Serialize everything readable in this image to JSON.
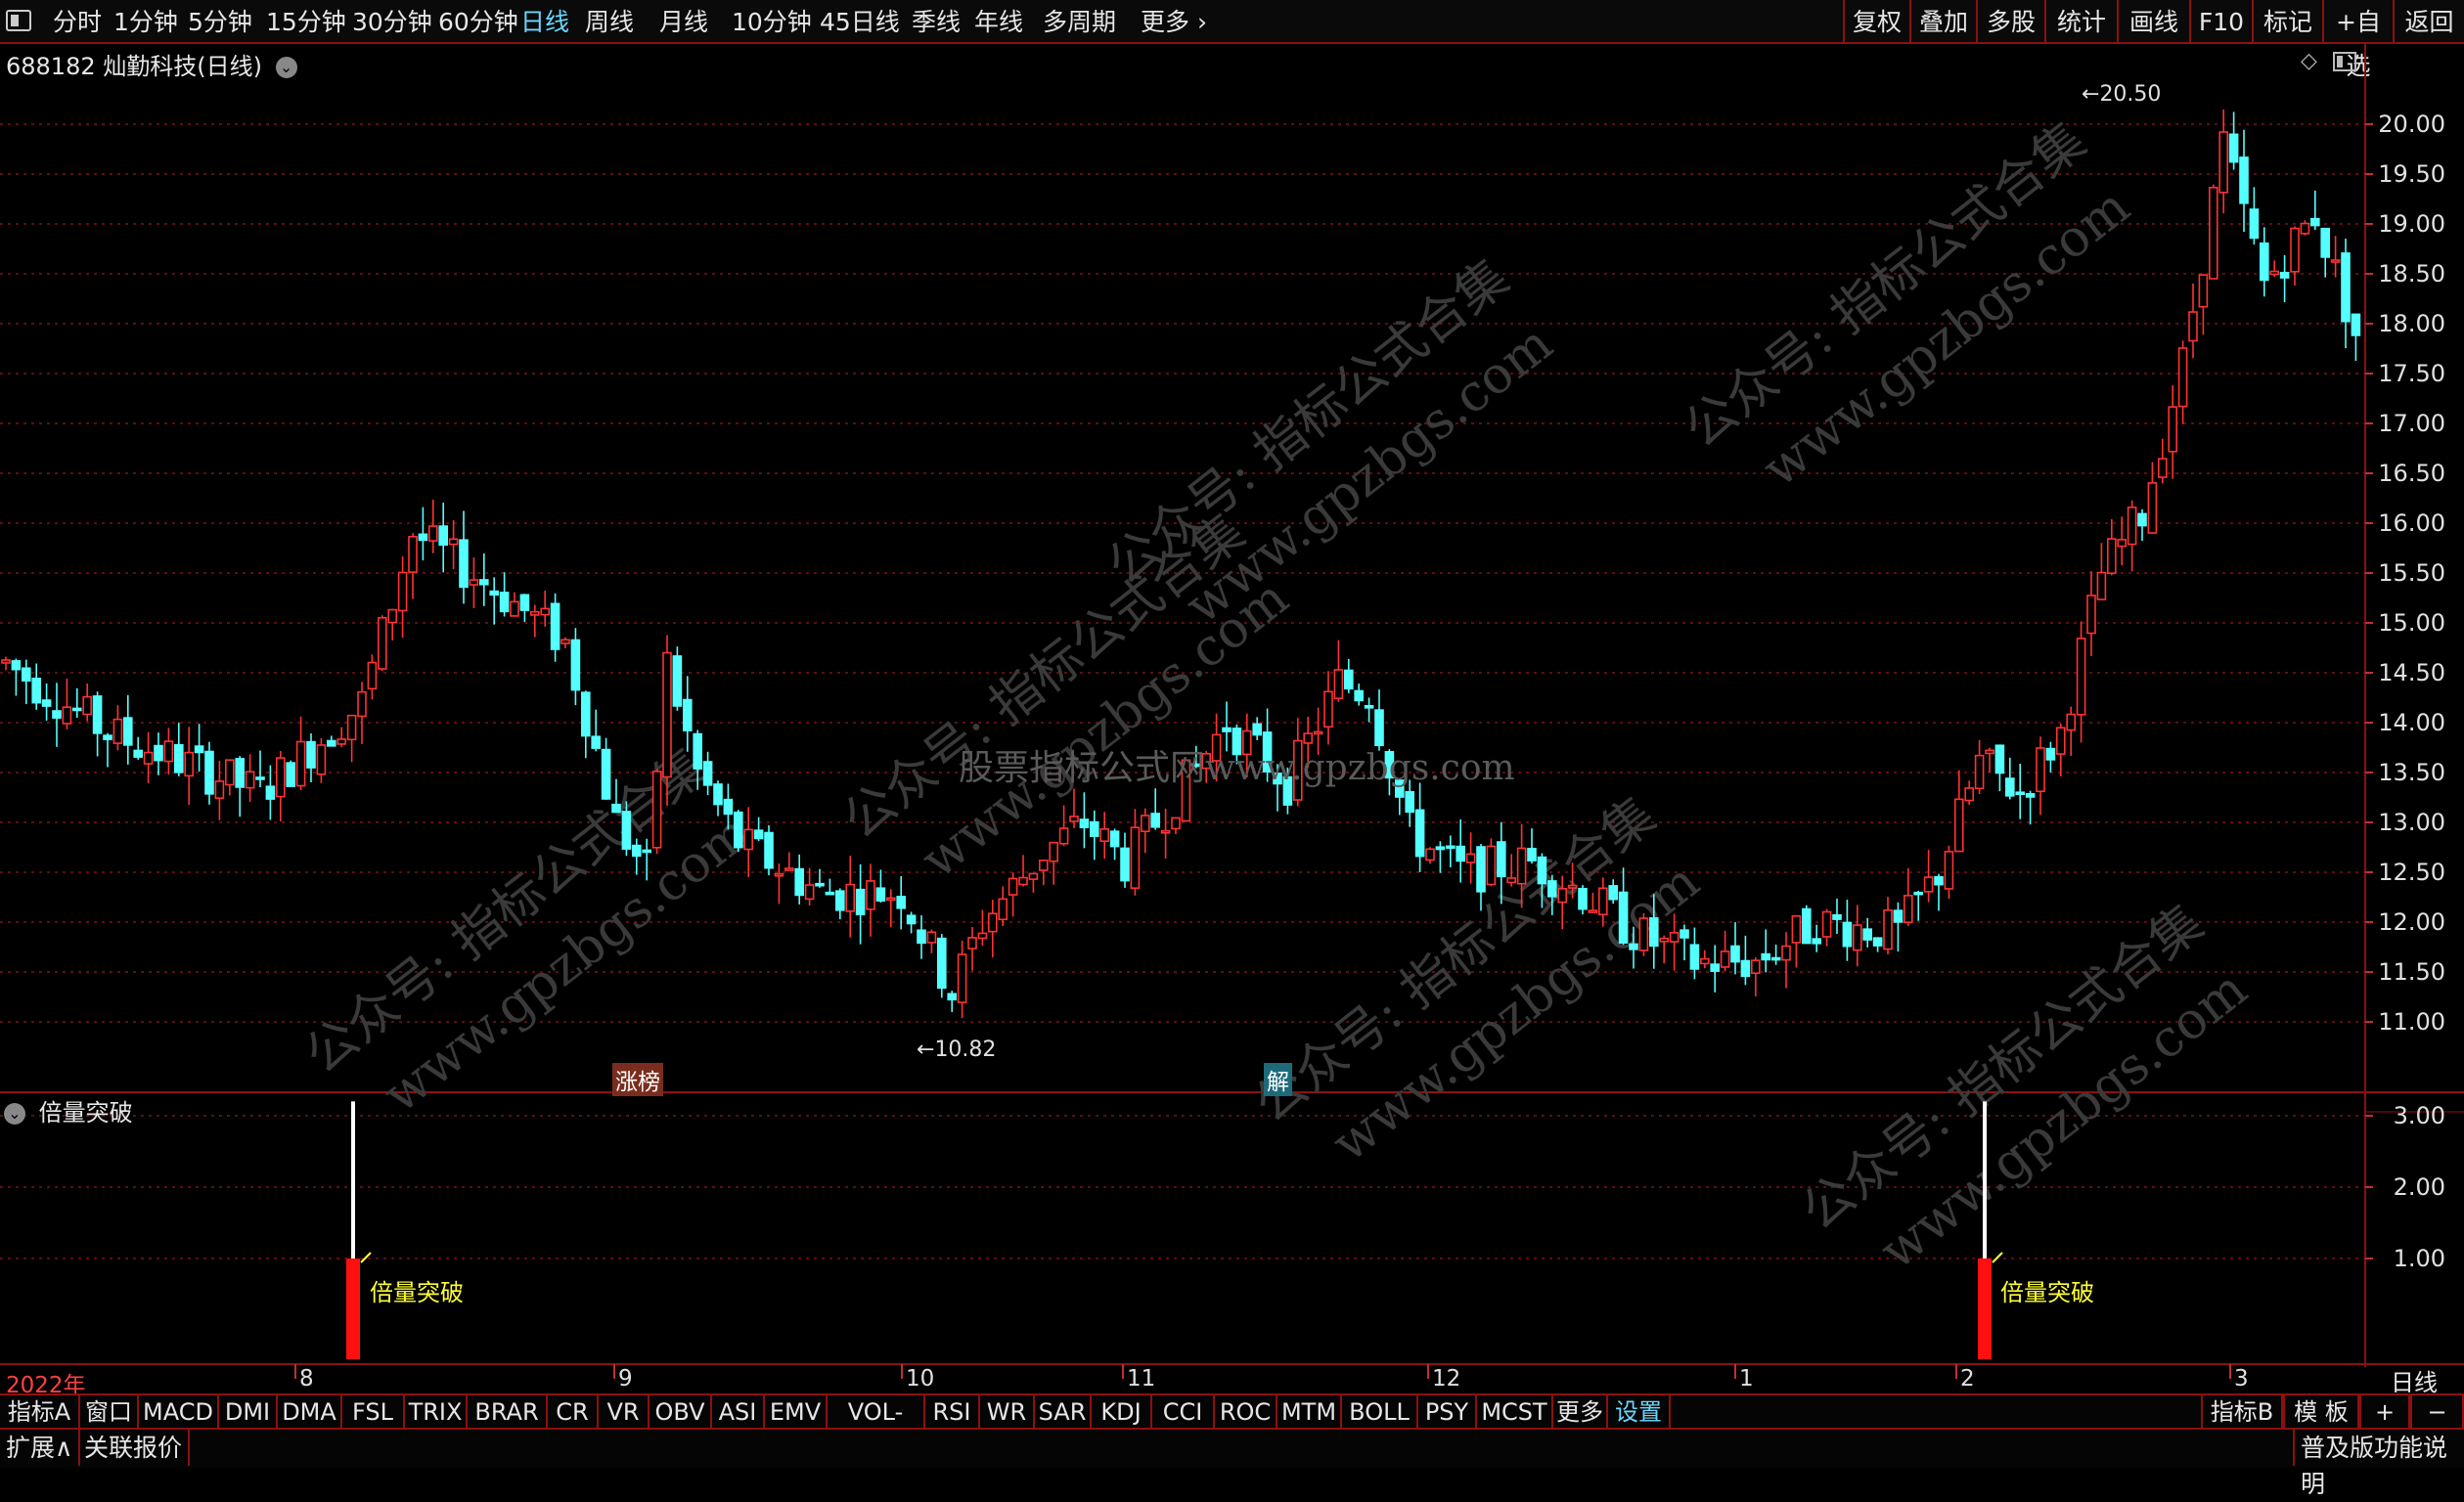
{
  "top_menu": {
    "periods": [
      "分时",
      "1分钟",
      "5分钟",
      "15分钟",
      "30分钟",
      "60分钟",
      "日线",
      "周线",
      "月线",
      "10分钟",
      "45日线",
      "季线",
      "年线",
      "多周期",
      "更多"
    ],
    "active_period": "日线",
    "right_buttons": [
      "复权",
      "叠加",
      "多股",
      "统计",
      "画线",
      "F10",
      "标记",
      "+自选",
      "返回"
    ]
  },
  "stock": {
    "title": "688182 灿勤科技(日线)"
  },
  "price_axis": {
    "ticks": [
      "20.00",
      "19.50",
      "19.00",
      "18.50",
      "18.00",
      "17.50",
      "17.00",
      "16.50",
      "16.00",
      "15.50",
      "15.00",
      "14.50",
      "14.00",
      "13.50",
      "13.00",
      "12.50",
      "12.00",
      "11.50",
      "11.00"
    ]
  },
  "annotations": {
    "high": "20.50",
    "low": "10.82",
    "tag_zhangbang": "涨榜",
    "tag_jie": "解"
  },
  "indicator": {
    "name": "倍量突破",
    "ticks": [
      "3.00",
      "2.00",
      "1.00"
    ],
    "signal_label_1": "倍量突破",
    "signal_label_2": "倍量突破"
  },
  "date_axis": {
    "labels": [
      "2022年",
      "8",
      "9",
      "10",
      "11",
      "12",
      "1",
      "2",
      "3"
    ],
    "period_label": "日线"
  },
  "watermarks": {
    "center": "股票指标公式网www.gpzbgs.com",
    "diag_1": "公众号: 指标公式合集",
    "diag_2": "www.gpzbgs.com"
  },
  "indicator_tabs": {
    "tabs": [
      "指标A",
      "窗口",
      "MACD",
      "DMI",
      "DMA",
      "FSL",
      "TRIX",
      "BRAR",
      "CR",
      "VR",
      "OBV",
      "ASI",
      "EMV",
      "VOL-TDX",
      "RSI",
      "WR",
      "SAR",
      "KDJ",
      "CCI",
      "ROC",
      "MTM",
      "BOLL",
      "PSY",
      "MCST",
      "更多",
      "设置"
    ],
    "active": "设置",
    "right": [
      "指标B",
      "模 板",
      "+",
      "−"
    ]
  },
  "status_bar": {
    "expand": "扩展∧",
    "linked_quote": "关联报价",
    "help": "普及版功能说明"
  },
  "colors": {
    "up": "#ff3232",
    "down": "#54ffff",
    "grid": "#7a1414",
    "axis_text": "#e0e0e0",
    "active": "#6ad8ff",
    "signal": "#ffff00"
  },
  "chart_data": {
    "type": "candlestick",
    "price_ylim": [
      10.5,
      20.7
    ],
    "indicator_ylim": [
      0,
      3.6
    ],
    "indicator_bars": [
      {
        "at_candle": 36,
        "value": 1.0,
        "spike": 3.2
      },
      {
        "at_candle": 205,
        "value": 1.0,
        "spike": 3.2
      }
    ],
    "high_point": 20.5,
    "low_point": 10.82
  }
}
